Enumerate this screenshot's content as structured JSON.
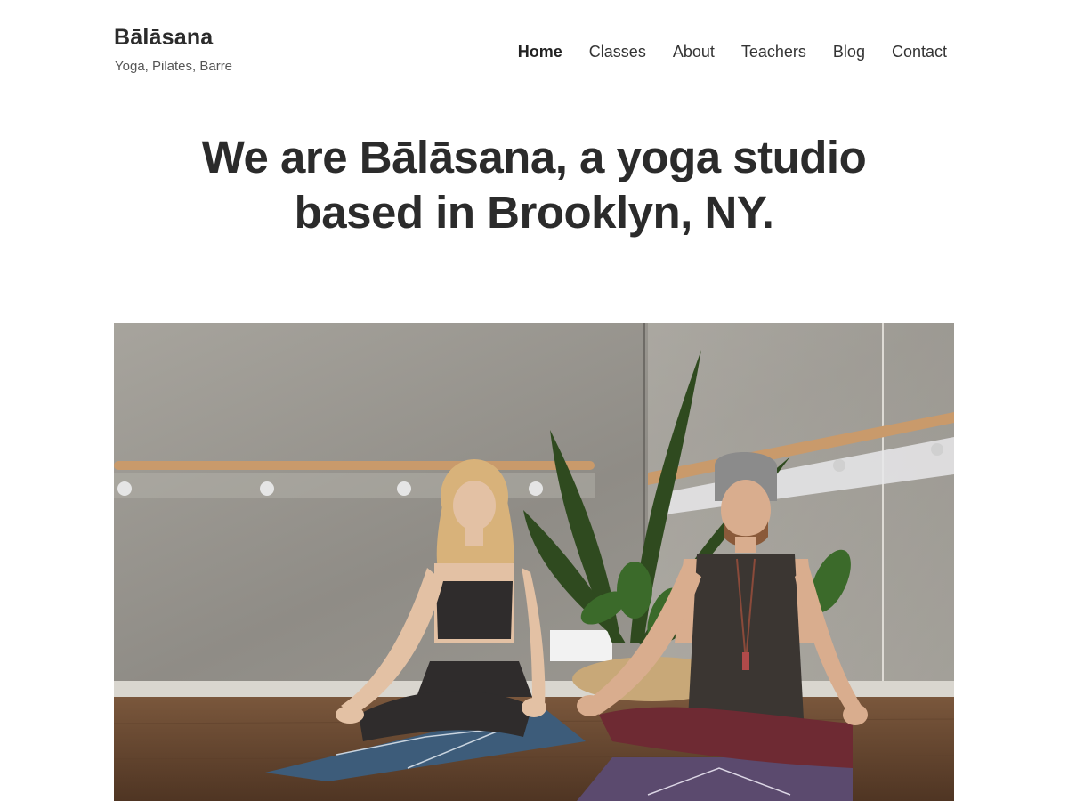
{
  "site": {
    "title": "Bālāsana",
    "tagline": "Yoga, Pilates, Barre"
  },
  "nav": {
    "items": [
      {
        "label": "Home",
        "active": true
      },
      {
        "label": "Classes",
        "active": false
      },
      {
        "label": "About",
        "active": false
      },
      {
        "label": "Teachers",
        "active": false
      },
      {
        "label": "Blog",
        "active": false
      },
      {
        "label": "Contact",
        "active": false
      }
    ]
  },
  "hero": {
    "heading_line1": "We are Bālāsana, a yoga studio",
    "heading_line2": "based in Brooklyn, NY."
  },
  "colors": {
    "text": "#2b2b2b",
    "background": "#ffffff",
    "wall": "#9a9790",
    "floor": "#6b4a32"
  }
}
